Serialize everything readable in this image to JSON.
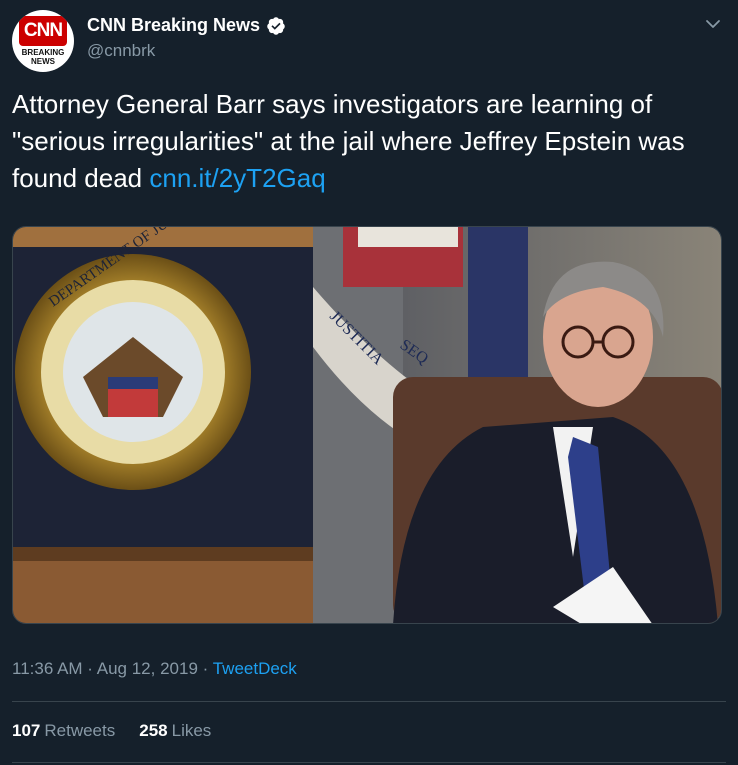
{
  "author": {
    "display_name": "CNN Breaking News",
    "handle": "@cnnbrk",
    "avatar_logo": "CNN",
    "avatar_sub_1": "BREAKING",
    "avatar_sub_2": "NEWS",
    "verified_icon": "verified-badge-icon"
  },
  "tweet": {
    "text": "Attorney General Barr says investigators are learning of \"serious irregularities\" at the jail where Jeffrey Epstein was found dead ",
    "link_text": "cnn.it/2yT2Gaq"
  },
  "media": {
    "seal_top_text": "DEPARTMENT OF JUSTICE",
    "banner_text_1": "JUSTITIA",
    "banner_text_2": "SEQ"
  },
  "meta": {
    "time": "11:36 AM",
    "separator": " · ",
    "date": "Aug 12, 2019",
    "source": "TweetDeck"
  },
  "stats": {
    "retweets_count": "107",
    "retweets_label": "Retweets",
    "likes_count": "258",
    "likes_label": "Likes"
  },
  "colors": {
    "background": "#15202b",
    "link": "#1da1f2",
    "muted": "#8899a6",
    "brand_red": "#cc0000"
  }
}
